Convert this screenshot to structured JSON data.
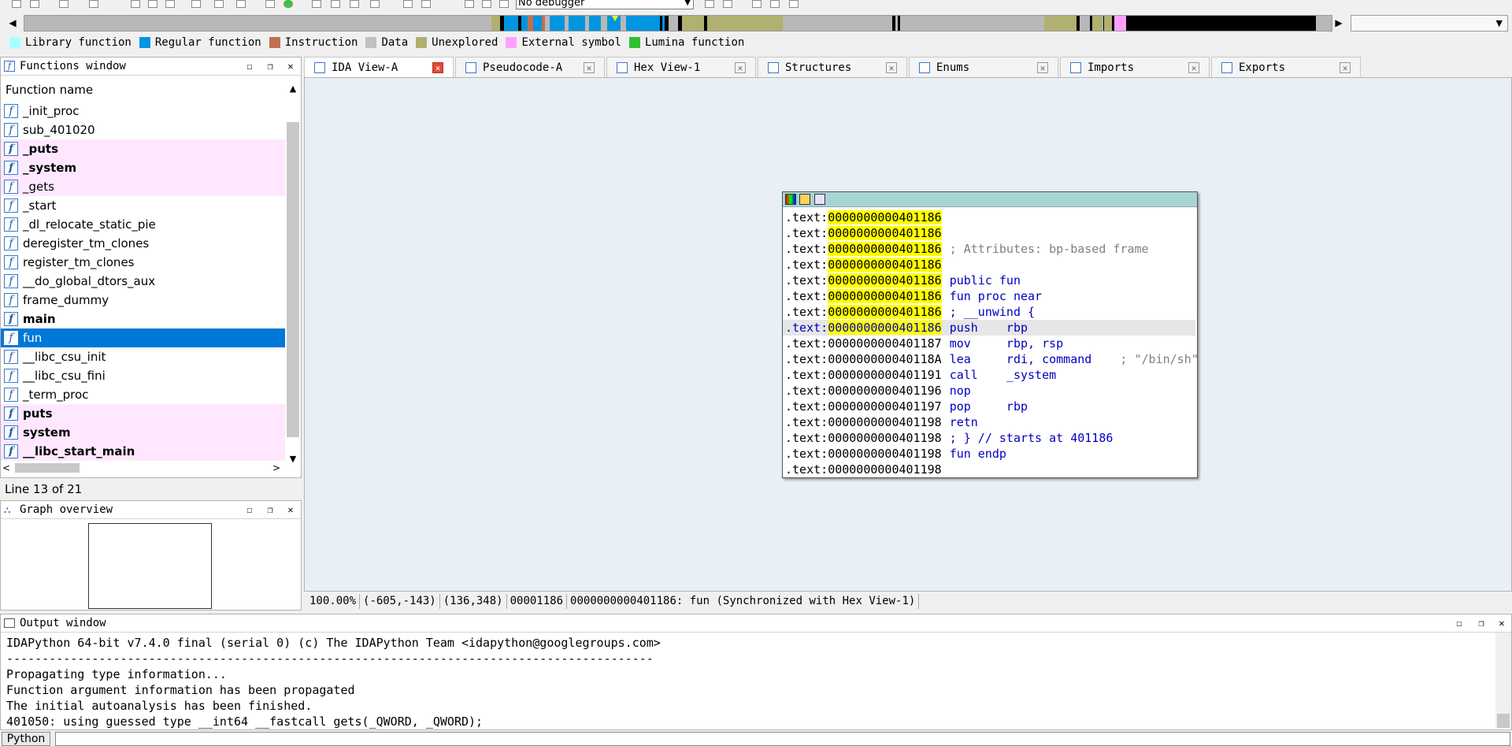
{
  "toolbar": {
    "debugger_label": "No debugger"
  },
  "legend": [
    {
      "label": "Library function",
      "color": "#aaffff"
    },
    {
      "label": "Regular function",
      "color": "#0095e0"
    },
    {
      "label": "Instruction",
      "color": "#c07050"
    },
    {
      "label": "Data",
      "color": "#c0c0c0"
    },
    {
      "label": "Unexplored",
      "color": "#b0b070"
    },
    {
      "label": "External symbol",
      "color": "#ffa0ff"
    },
    {
      "label": "Lumina function",
      "color": "#30c030"
    }
  ],
  "functions_window": {
    "title": "Functions window",
    "column_header": "Function name",
    "items": [
      {
        "name": "_init_proc",
        "style": "normal"
      },
      {
        "name": "sub_401020",
        "style": "normal"
      },
      {
        "name": "_puts",
        "style": "lib-bold"
      },
      {
        "name": "_system",
        "style": "lib-bold"
      },
      {
        "name": "_gets",
        "style": "lib"
      },
      {
        "name": "_start",
        "style": "normal"
      },
      {
        "name": "_dl_relocate_static_pie",
        "style": "normal"
      },
      {
        "name": "deregister_tm_clones",
        "style": "normal"
      },
      {
        "name": "register_tm_clones",
        "style": "normal"
      },
      {
        "name": "__do_global_dtors_aux",
        "style": "normal"
      },
      {
        "name": "frame_dummy",
        "style": "normal"
      },
      {
        "name": "main",
        "style": "bold"
      },
      {
        "name": "fun",
        "style": "selected"
      },
      {
        "name": "__libc_csu_init",
        "style": "normal"
      },
      {
        "name": "__libc_csu_fini",
        "style": "normal"
      },
      {
        "name": "_term_proc",
        "style": "normal"
      },
      {
        "name": "puts",
        "style": "lib-bold"
      },
      {
        "name": "system",
        "style": "lib-bold"
      },
      {
        "name": "__libc_start_main",
        "style": "lib-bold"
      }
    ],
    "status": "Line 13 of 21"
  },
  "graph_overview": {
    "title": "Graph overview"
  },
  "tabs": [
    {
      "label": "IDA View-A",
      "active": true
    },
    {
      "label": "Pseudocode-A",
      "active": false
    },
    {
      "label": "Hex View-1",
      "active": false
    },
    {
      "label": "Structures",
      "active": false
    },
    {
      "label": "Enums",
      "active": false
    },
    {
      "label": "Imports",
      "active": false
    },
    {
      "label": "Exports",
      "active": false
    }
  ],
  "code": {
    "lines": [
      {
        "seg": ".text:",
        "addr": "0000000000401186",
        "hl": true,
        "text": "",
        "cmt": ""
      },
      {
        "seg": ".text:",
        "addr": "0000000000401186",
        "hl": true,
        "text": "",
        "cmt": ""
      },
      {
        "seg": ".text:",
        "addr": "0000000000401186",
        "hl": true,
        "text": "",
        "cmt": "; Attributes: bp-based frame"
      },
      {
        "seg": ".text:",
        "addr": "0000000000401186",
        "hl": true,
        "text": "",
        "cmt": ""
      },
      {
        "seg": ".text:",
        "addr": "0000000000401186",
        "hl": true,
        "text": "public fun",
        "cmt": ""
      },
      {
        "seg": ".text:",
        "addr": "0000000000401186",
        "hl": true,
        "text": "fun proc near",
        "cmt": ""
      },
      {
        "seg": ".text:",
        "addr": "0000000000401186",
        "hl": true,
        "text": "; __unwind {",
        "cmt": ""
      },
      {
        "seg": ".text:",
        "addr": "0000000000401186",
        "hl": true,
        "text": "push    rbp",
        "cmt": "",
        "cur": true
      },
      {
        "seg": ".text:",
        "addr": "0000000000401187",
        "hl": false,
        "text": "mov     rbp, rsp",
        "cmt": ""
      },
      {
        "seg": ".text:",
        "addr": "000000000040118A",
        "hl": false,
        "text": "lea     rdi, command",
        "cmt": "",
        "inline": "    ; \"/bin/sh\""
      },
      {
        "seg": ".text:",
        "addr": "0000000000401191",
        "hl": false,
        "text": "call    _system",
        "cmt": ""
      },
      {
        "seg": ".text:",
        "addr": "0000000000401196",
        "hl": false,
        "text": "nop",
        "cmt": ""
      },
      {
        "seg": ".text:",
        "addr": "0000000000401197",
        "hl": false,
        "text": "pop     rbp",
        "cmt": ""
      },
      {
        "seg": ".text:",
        "addr": "0000000000401198",
        "hl": false,
        "text": "retn",
        "cmt": ""
      },
      {
        "seg": ".text:",
        "addr": "0000000000401198",
        "hl": false,
        "text": "; } // starts at 401186",
        "cmt": ""
      },
      {
        "seg": ".text:",
        "addr": "0000000000401198",
        "hl": false,
        "text": "fun endp",
        "cmt": ""
      },
      {
        "seg": ".text:",
        "addr": "0000000000401198",
        "hl": false,
        "text": "",
        "cmt": ""
      }
    ]
  },
  "ida_status": [
    "100.00%",
    "(-605,-143)",
    "(136,348)",
    "00001186",
    "0000000000401186: fun (Synchronized with Hex View-1)"
  ],
  "output_window": {
    "title": "Output window",
    "lines": [
      "IDAPython 64-bit v7.4.0 final (serial 0) (c) The IDAPython Team <idapython@googlegroups.com>",
      "-------------------------------------------------------------------------------------------",
      "Propagating type information...",
      "Function argument information has been propagated",
      "The initial autoanalysis has been finished.",
      "401050: using guessed type __int64 __fastcall gets(_QWORD, _QWORD);"
    ]
  },
  "python_button": "Python",
  "nav_segments": [
    {
      "from": 0.0,
      "to": 0.357,
      "color": "#b8b8b8"
    },
    {
      "from": 0.357,
      "to": 0.364,
      "color": "#b0b070"
    },
    {
      "from": 0.364,
      "to": 0.367,
      "color": "#000000"
    },
    {
      "from": 0.367,
      "to": 0.378,
      "color": "#0095e0"
    },
    {
      "from": 0.378,
      "to": 0.38,
      "color": "#000000"
    },
    {
      "from": 0.38,
      "to": 0.385,
      "color": "#0095e0"
    },
    {
      "from": 0.385,
      "to": 0.389,
      "color": "#c07050"
    },
    {
      "from": 0.389,
      "to": 0.396,
      "color": "#0095e0"
    },
    {
      "from": 0.396,
      "to": 0.398,
      "color": "#c07050"
    },
    {
      "from": 0.398,
      "to": 0.402,
      "color": "#b8b8b8"
    },
    {
      "from": 0.402,
      "to": 0.413,
      "color": "#0095e0"
    },
    {
      "from": 0.413,
      "to": 0.416,
      "color": "#b8b8b8"
    },
    {
      "from": 0.416,
      "to": 0.429,
      "color": "#0095e0"
    },
    {
      "from": 0.429,
      "to": 0.432,
      "color": "#b8b8b8"
    },
    {
      "from": 0.432,
      "to": 0.441,
      "color": "#0095e0"
    },
    {
      "from": 0.441,
      "to": 0.446,
      "color": "#b8b8b8"
    },
    {
      "from": 0.446,
      "to": 0.456,
      "color": "#0095e0"
    },
    {
      "from": 0.456,
      "to": 0.46,
      "color": "#b8b8b8"
    },
    {
      "from": 0.46,
      "to": 0.486,
      "color": "#0095e0"
    },
    {
      "from": 0.486,
      "to": 0.488,
      "color": "#000000"
    },
    {
      "from": 0.488,
      "to": 0.49,
      "color": "#0095e0"
    },
    {
      "from": 0.49,
      "to": 0.493,
      "color": "#000000"
    },
    {
      "from": 0.493,
      "to": 0.5,
      "color": "#b8b8b8"
    },
    {
      "from": 0.5,
      "to": 0.503,
      "color": "#000000"
    },
    {
      "from": 0.503,
      "to": 0.52,
      "color": "#b0b070"
    },
    {
      "from": 0.52,
      "to": 0.522,
      "color": "#000000"
    },
    {
      "from": 0.522,
      "to": 0.58,
      "color": "#b0b070"
    },
    {
      "from": 0.58,
      "to": 0.664,
      "color": "#b8b8b8"
    },
    {
      "from": 0.664,
      "to": 0.666,
      "color": "#000000"
    },
    {
      "from": 0.666,
      "to": 0.668,
      "color": "#b8b8b8"
    },
    {
      "from": 0.668,
      "to": 0.67,
      "color": "#000000"
    },
    {
      "from": 0.67,
      "to": 0.78,
      "color": "#b8b8b8"
    },
    {
      "from": 0.78,
      "to": 0.805,
      "color": "#b0b070"
    },
    {
      "from": 0.805,
      "to": 0.807,
      "color": "#000000"
    },
    {
      "from": 0.807,
      "to": 0.815,
      "color": "#b8b8b8"
    },
    {
      "from": 0.815,
      "to": 0.817,
      "color": "#000000"
    },
    {
      "from": 0.817,
      "to": 0.825,
      "color": "#b0b070"
    },
    {
      "from": 0.825,
      "to": 0.826,
      "color": "#000000"
    },
    {
      "from": 0.826,
      "to": 0.832,
      "color": "#b0b070"
    },
    {
      "from": 0.832,
      "to": 0.834,
      "color": "#000000"
    },
    {
      "from": 0.834,
      "to": 0.843,
      "color": "#ffa0ff"
    },
    {
      "from": 0.843,
      "to": 0.988,
      "color": "#000000"
    },
    {
      "from": 0.988,
      "to": 1.0,
      "color": "#b8b8b8"
    }
  ],
  "nav_cursor": 0.452
}
